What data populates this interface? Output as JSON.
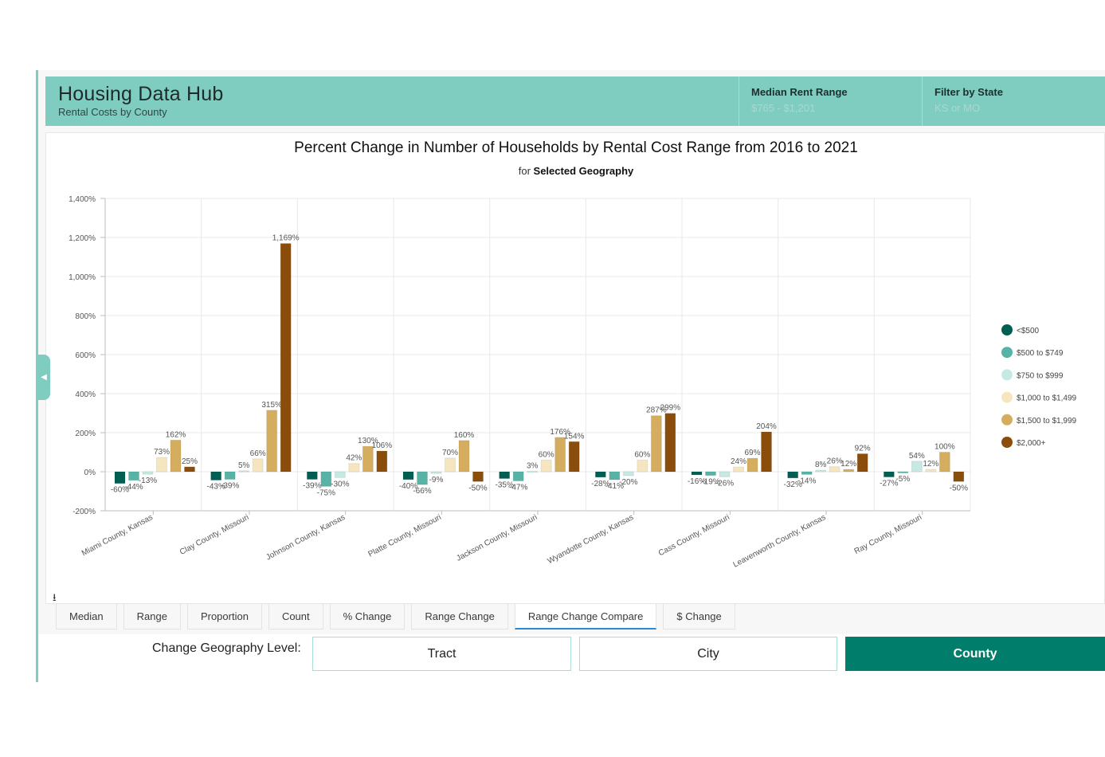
{
  "header": {
    "title": "Housing Data Hub",
    "subtitle": "Rental Costs by County",
    "stats": [
      {
        "label": "Median Rent Range",
        "value": "$765 - $1,201"
      },
      {
        "label": "Filter by State",
        "value": "KS or MO"
      }
    ]
  },
  "icons": {
    "collapse": "◀",
    "download": "⭳"
  },
  "chart_data": {
    "type": "bar",
    "title": "Percent Change in Number of Households by Rental Cost Range from 2016 to 2021",
    "subtitle_prefix": "for",
    "subtitle_bold": "Selected Geography",
    "xlabel": "",
    "ylabel": "",
    "ylim": [
      -200,
      1400
    ],
    "yticks": [
      -200,
      0,
      200,
      400,
      600,
      800,
      1000,
      1200,
      1400
    ],
    "ytick_labels": [
      "-200%",
      "0%",
      "200%",
      "400%",
      "600%",
      "800%",
      "1,000%",
      "1,200%",
      "1,400%"
    ],
    "grid": true,
    "legend_position": "right",
    "categories": [
      "Miami County, Kansas",
      "Clay County, Missouri",
      "Johnson County, Kansas",
      "Platte County, Missouri",
      "Jackson County, Missouri",
      "Wyandotte County, Kansas",
      "Cass County, Missouri",
      "Leavenworth County, Kansas",
      "Ray County, Missouri"
    ],
    "series": [
      {
        "name": "<$500",
        "color": "#005e52",
        "values": [
          -60,
          -43,
          -39,
          -40,
          -35,
          -28,
          -16,
          -32,
          -27
        ]
      },
      {
        "name": "$500 to $749",
        "color": "#57b3a6",
        "values": [
          -44,
          -39,
          -75,
          -66,
          -47,
          -41,
          -19,
          -14,
          -5
        ]
      },
      {
        "name": "$750 to $999",
        "color": "#c6e9e2",
        "values": [
          -13,
          5,
          -30,
          -9,
          3,
          -20,
          -26,
          8,
          54
        ]
      },
      {
        "name": "$1,000 to $1,499",
        "color": "#f5e6bf",
        "values": [
          73,
          66,
          42,
          70,
          60,
          60,
          24,
          26,
          12
        ]
      },
      {
        "name": "$1,500 to $1,999",
        "color": "#d4ad5e",
        "values": [
          162,
          315,
          130,
          160,
          176,
          287,
          69,
          12,
          100
        ]
      },
      {
        "name": "$2,000+",
        "color": "#8a4d0c",
        "values": [
          25,
          1169,
          106,
          -50,
          154,
          299,
          204,
          92,
          -50
        ]
      }
    ]
  },
  "tabs": [
    {
      "label": "Median",
      "active": false
    },
    {
      "label": "Range",
      "active": false
    },
    {
      "label": "Proportion",
      "active": false
    },
    {
      "label": "Count",
      "active": false
    },
    {
      "label": "% Change",
      "active": false
    },
    {
      "label": "Range Change",
      "active": false
    },
    {
      "label": "Range Change Compare",
      "active": true
    },
    {
      "label": "$ Change",
      "active": false
    }
  ],
  "geography": {
    "label": "Change Geography Level:",
    "options": [
      {
        "label": "Tract",
        "selected": false
      },
      {
        "label": "City",
        "selected": false
      },
      {
        "label": "County",
        "selected": true
      }
    ]
  }
}
